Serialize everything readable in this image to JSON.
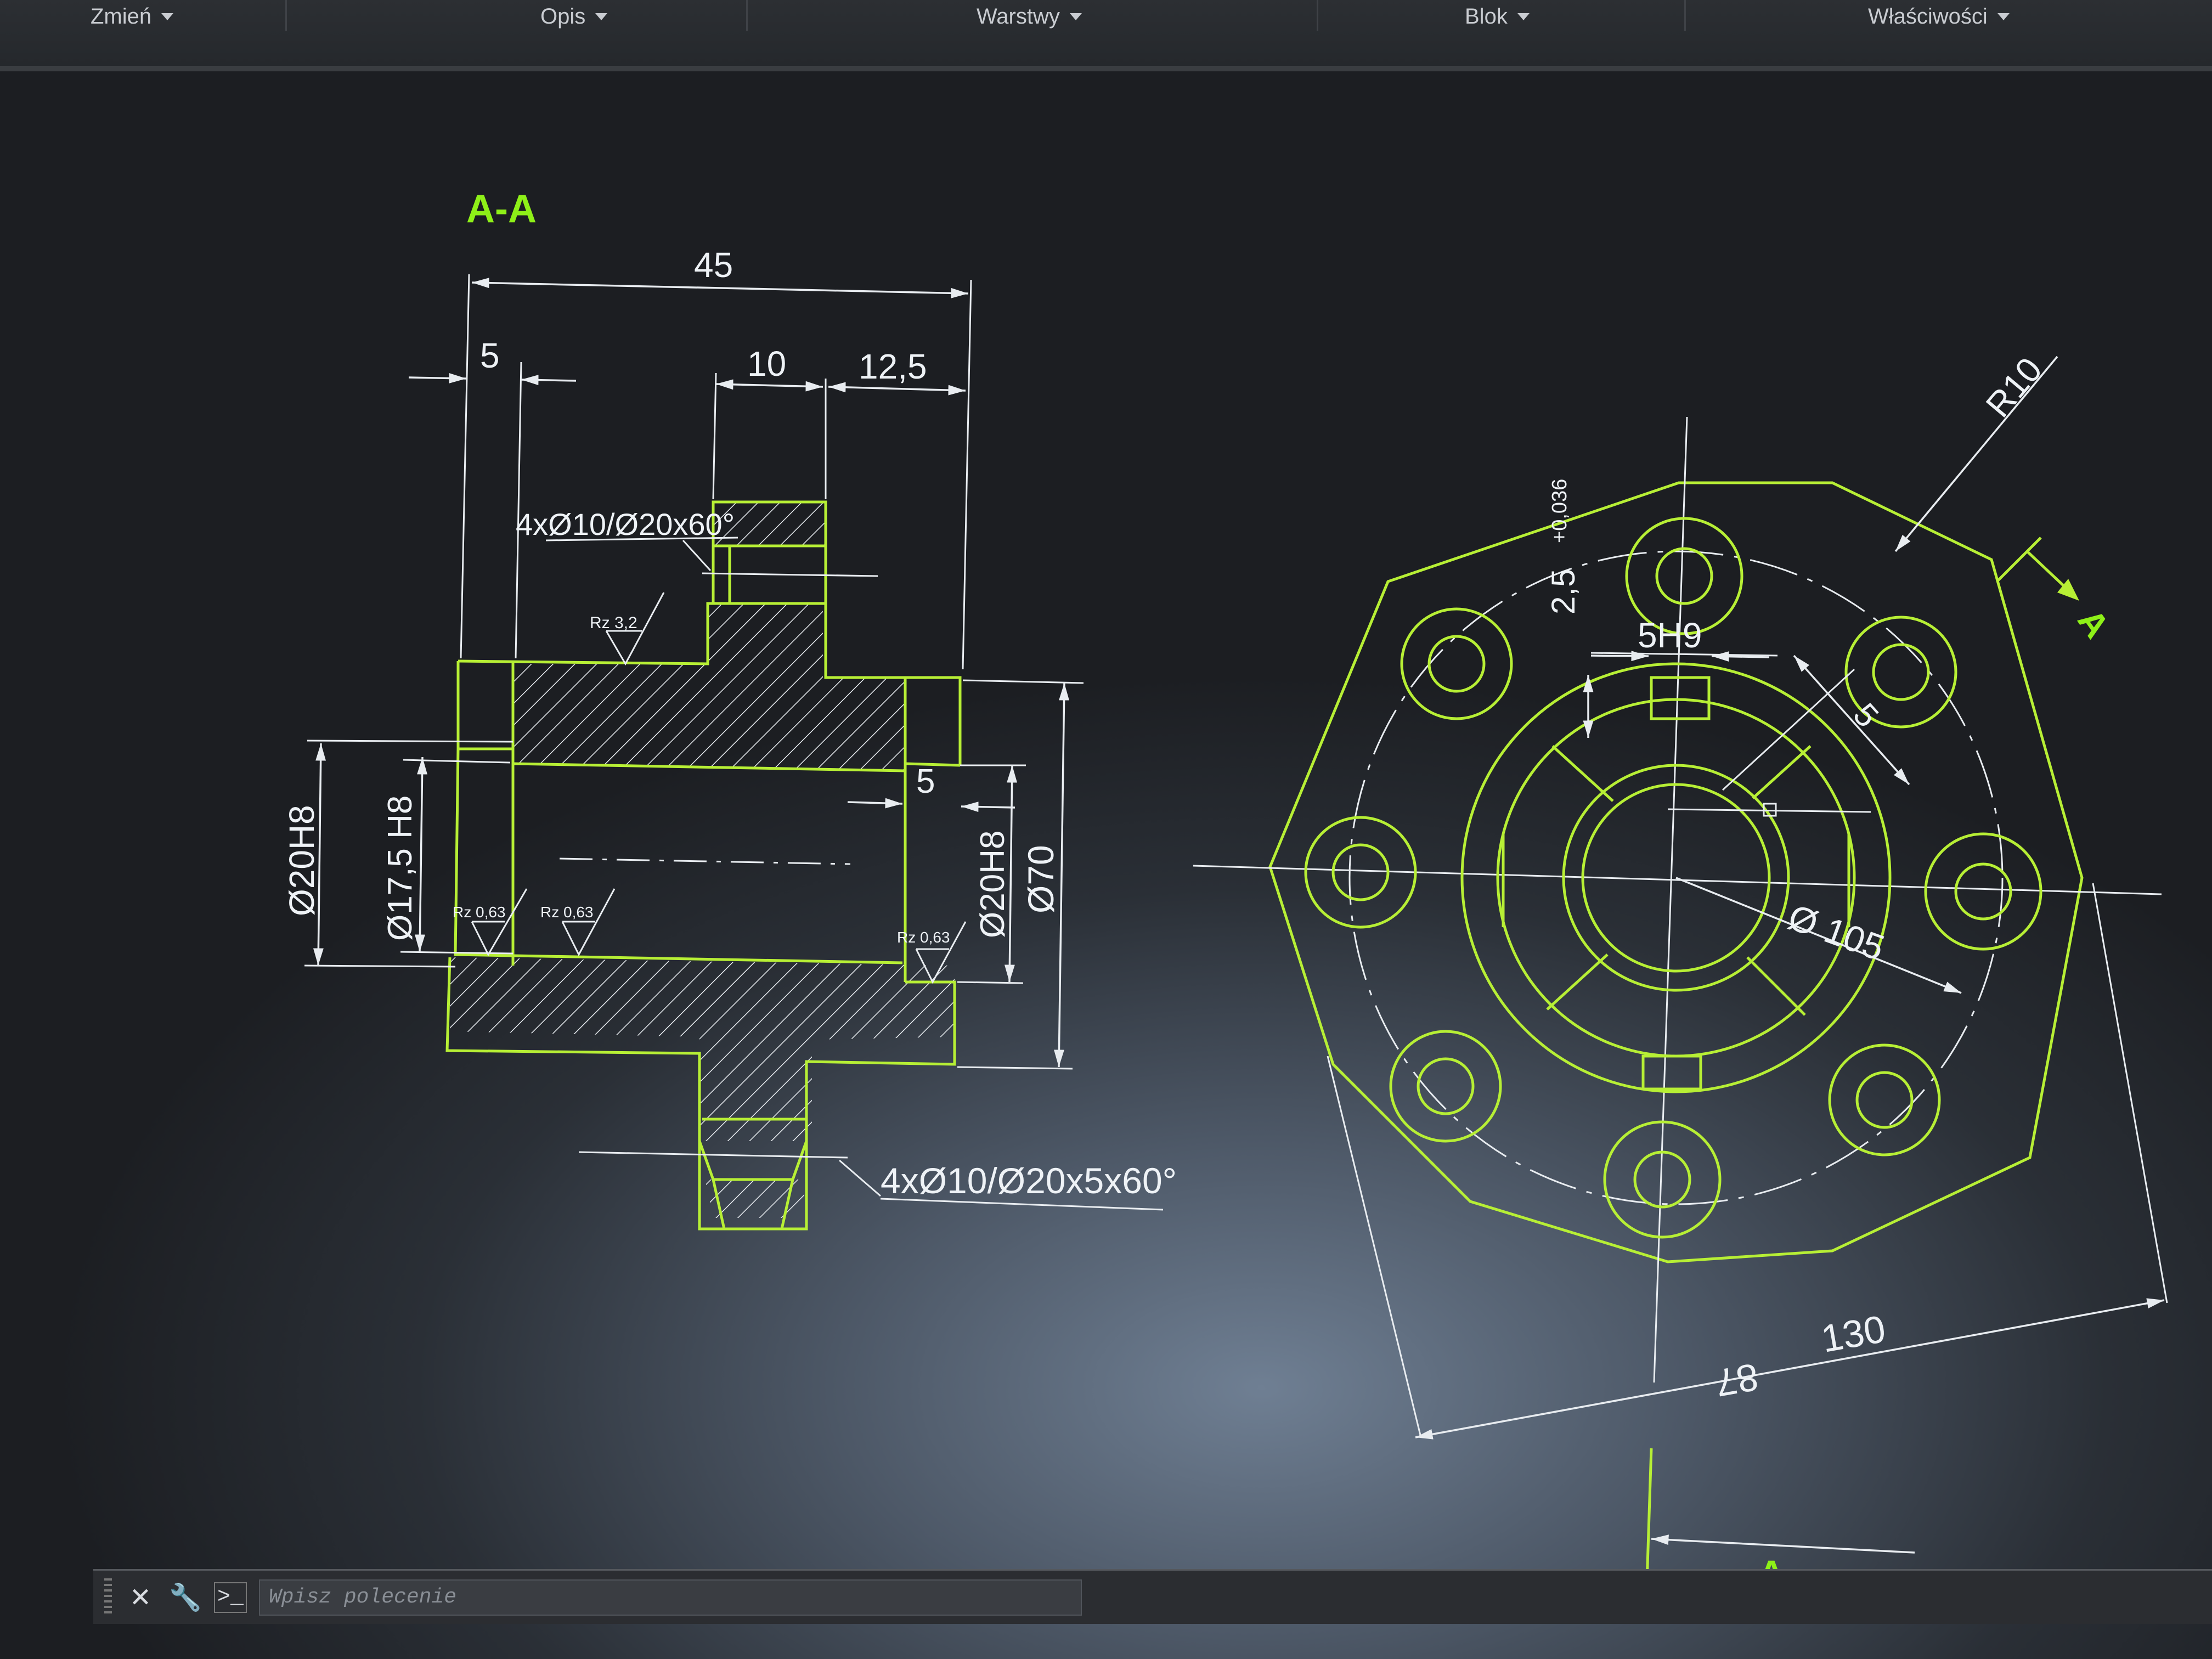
{
  "ribbon": {
    "panels": [
      {
        "label": "Zmień"
      },
      {
        "label": "Opis"
      },
      {
        "label": "Warstwy"
      },
      {
        "label": "Blok"
      },
      {
        "label": "Właściwości"
      }
    ]
  },
  "drawing": {
    "section_title": "A-A",
    "view_marker": "A",
    "section_arrow_label": "A",
    "dims": {
      "overall_length": "45",
      "left_offset": "5",
      "boss_width": "10",
      "right_length": "12,5",
      "inner_step": "5",
      "bore_left": "Ø20H8",
      "bore_mid": "Ø17,5 H8",
      "bore_right": "Ø20H8",
      "outer_dia": "Ø70",
      "hole_note_top": "4xØ10/Ø20x60°",
      "hole_note_bottom": "4xØ10/Ø20x5x60°",
      "keyway_width": "5H9",
      "keyway_depth": "2,5",
      "keyway_tol": "+0,036",
      "chamfer": "5",
      "radius": "R10",
      "pitch_circle": "Ø 105",
      "across_flats": "130",
      "across_flats_rot": "87",
      "roughness_coarse": "Rz 3,2",
      "roughness_fine": "Rz 0,63"
    }
  },
  "command_line": {
    "placeholder": "Wpisz polecenie",
    "close_icon": "close-icon",
    "settings_icon": "wrench-icon",
    "prompt_icon": "prompt-icon"
  },
  "colors": {
    "geometry": "#b7ef35",
    "dimensions": "#e8ecf0",
    "section_label": "#8ef018"
  }
}
